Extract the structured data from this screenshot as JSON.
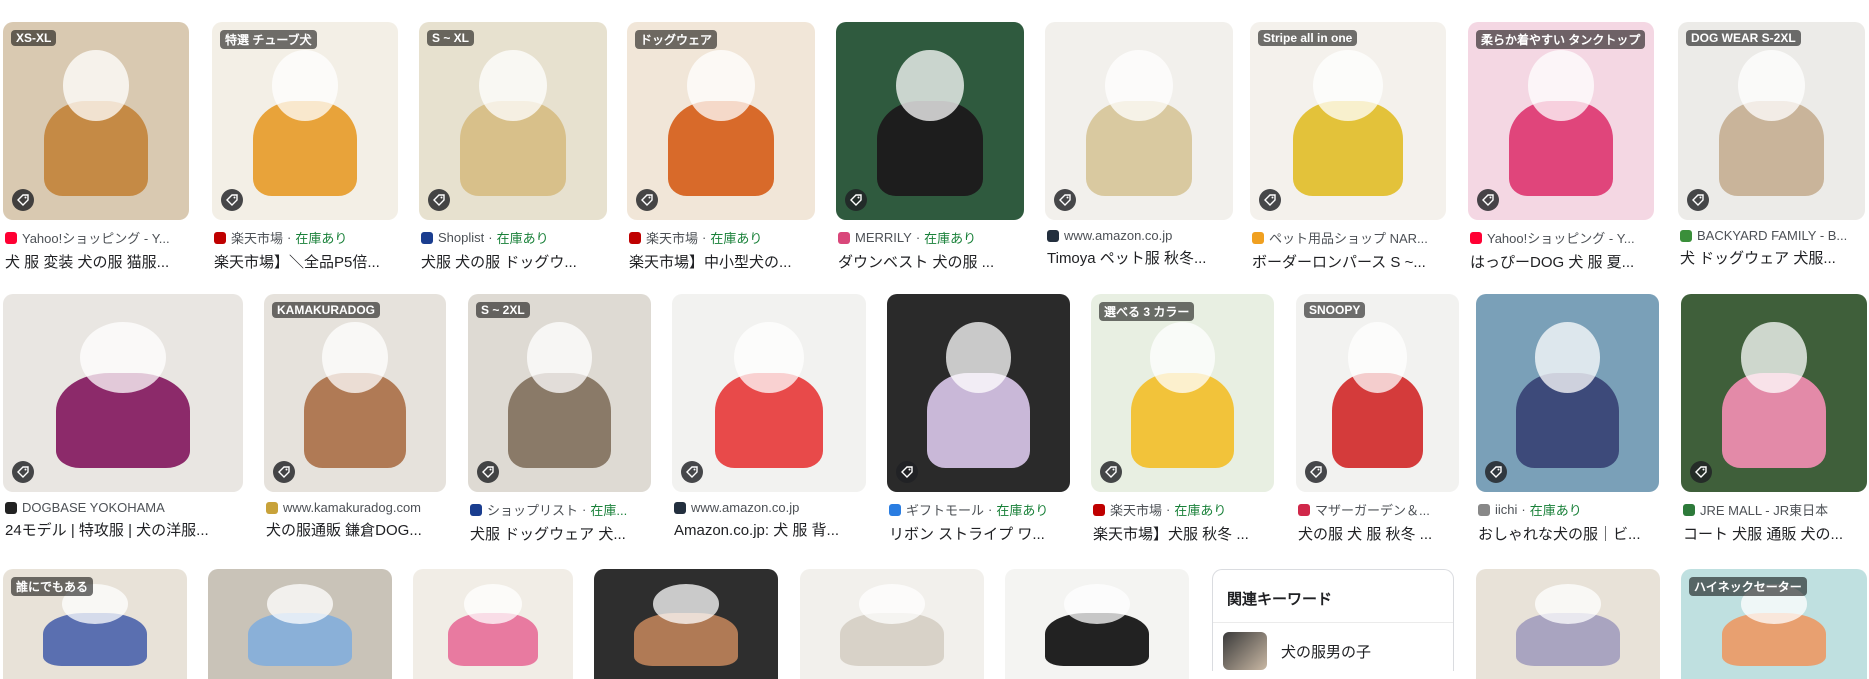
{
  "rows": [
    [
      {
        "source": "Yahoo!ショッピング - Y...",
        "stock": "",
        "title": "犬 服 変装 犬の服 猫服...",
        "favicon": "#ff0033",
        "overlay": "XS-XL",
        "bg": "#d9c9b1",
        "art": "#c58a45"
      },
      {
        "source": "楽天市場",
        "stock": "在庫あり",
        "title": "楽天市場】＼全品P5倍...",
        "favicon": "#bf0000",
        "overlay": "特選 チューブ犬",
        "bg": "#f3efe6",
        "art": "#e8a33a"
      },
      {
        "source": "Shoplist",
        "stock": "在庫あり",
        "title": "犬服 犬の服 ドッグウ...",
        "favicon": "#1a3d8f",
        "overlay": "S ~ XL",
        "bg": "#e7e1cf",
        "art": "#d8c08a"
      },
      {
        "source": "楽天市場",
        "stock": "在庫あり",
        "title": "楽天市場】中小型犬の...",
        "favicon": "#bf0000",
        "overlay": "ドッグウェア",
        "bg": "#f1e6d8",
        "art": "#d86a2a"
      },
      {
        "source": "MERRILY",
        "stock": "在庫あり",
        "title": "ダウンベスト 犬の服 ...",
        "favicon": "#d9477a",
        "overlay": "",
        "bg": "#2f5a3e",
        "art": "#1d1d1d"
      },
      {
        "source": "www.amazon.co.jp",
        "stock": "",
        "title": "Timoya ペット服 秋冬...",
        "favicon": "#232f3e",
        "overlay": "",
        "bg": "#f2f0ec",
        "art": "#d9c9a0"
      },
      {
        "source": "ペット用品ショップ NAR...",
        "stock": "",
        "title": "ボーダーロンパース S ~...",
        "favicon": "#f0a020",
        "overlay": "Stripe all in one",
        "bg": "#f4f1ec",
        "art": "#e3c23a"
      },
      {
        "source": "Yahoo!ショッピング - Y...",
        "stock": "",
        "title": "はっぴーDOG 犬 服 夏...",
        "favicon": "#ff0033",
        "overlay": "柔らか着やすい タンクトップ",
        "bg": "#f4d7e3",
        "art": "#e0457b"
      },
      {
        "source": "BACKYARD FAMILY - B...",
        "stock": "",
        "title": "犬 ドッグウェア 犬服...",
        "favicon": "#3a8f3a",
        "overlay": "DOG WEAR S-2XL",
        "bg": "#ecebe8",
        "art": "#c9b49a"
      }
    ],
    [
      {
        "source": "DOGBASE YOKOHAMA",
        "stock": "",
        "title": "24モデル | 特攻服 | 犬の洋服...",
        "favicon": "#222222",
        "overlay": "",
        "bg": "#e9e6e2",
        "art": "#8c2a6a"
      },
      {
        "source": "www.kamakuradog.com",
        "stock": "",
        "title": "犬の服通販 鎌倉DOG...",
        "favicon": "#c8a23a",
        "overlay": "KAMAKURADOG",
        "bg": "#e6e2dc",
        "art": "#b07a55"
      },
      {
        "source": "ショップリスト",
        "stock": "在庫...",
        "title": "犬服 ドッグウェア 犬...",
        "favicon": "#1a3d8f",
        "overlay": "S ~ 2XL",
        "bg": "#dedad3",
        "art": "#8a7a68"
      },
      {
        "source": "www.amazon.co.jp",
        "stock": "",
        "title": "Amazon.co.jp: 犬 服 背...",
        "favicon": "#232f3e",
        "overlay": "",
        "bg": "#f2f2f0",
        "art": "#e84a4a"
      },
      {
        "source": "ギフトモール",
        "stock": "在庫あり",
        "title": "リボン ストライプ ワ...",
        "favicon": "#2a7de1",
        "overlay": "",
        "bg": "#2a2a2a",
        "art": "#c9b8d8"
      },
      {
        "source": "楽天市場",
        "stock": "在庫あり",
        "title": "楽天市場】犬服 秋冬 ...",
        "favicon": "#bf0000",
        "overlay": "選べる 3 カラー",
        "bg": "#e8efe2",
        "art": "#f2c33a"
      },
      {
        "source": "マザーガーデン＆...",
        "stock": "",
        "title": "犬の服 犬 服 秋冬 ...",
        "favicon": "#d0284a",
        "overlay": "SNOOPY",
        "bg": "#f2f2f0",
        "art": "#d43b3b"
      },
      {
        "source": "iichi",
        "stock": "在庫あり",
        "title": "おしゃれな犬の服｜ビ...",
        "favicon": "#888888",
        "overlay": "",
        "bg": "#7aa0b8",
        "art": "#3d4a7a"
      },
      {
        "source": "JRE MALL - JR東日本",
        "stock": "",
        "title": "コート 犬服 通販 犬の...",
        "favicon": "#2d7a3a",
        "overlay": "",
        "bg": "#3f5f3a",
        "art": "#e38aa8"
      }
    ],
    [
      {
        "overlay": "誰にでもある",
        "bg": "#e8e2d8",
        "art": "#5a6fb0"
      },
      {
        "overlay": "",
        "bg": "#c9c3b8",
        "art": "#8ab0d8"
      },
      {
        "overlay": "",
        "bg": "#f1ede6",
        "art": "#e87aa0"
      },
      {
        "overlay": "",
        "bg": "#2e2e2e",
        "art": "#b07a55"
      },
      {
        "overlay": "",
        "bg": "#f2f0ec",
        "art": "#d8d2c8"
      },
      {
        "overlay": "",
        "bg": "#f4f4f2",
        "art": "#222222"
      },
      {
        "overlay": "",
        "bg": "#e8e2d8",
        "art": "#a9a4c0"
      },
      {
        "overlay": "ハイネックセーター",
        "bg": "#bfe0e0",
        "art": "#e8a070"
      }
    ]
  ],
  "related": {
    "heading": "関連キーワード",
    "items": [
      {
        "label": "犬の服男の子"
      }
    ]
  }
}
